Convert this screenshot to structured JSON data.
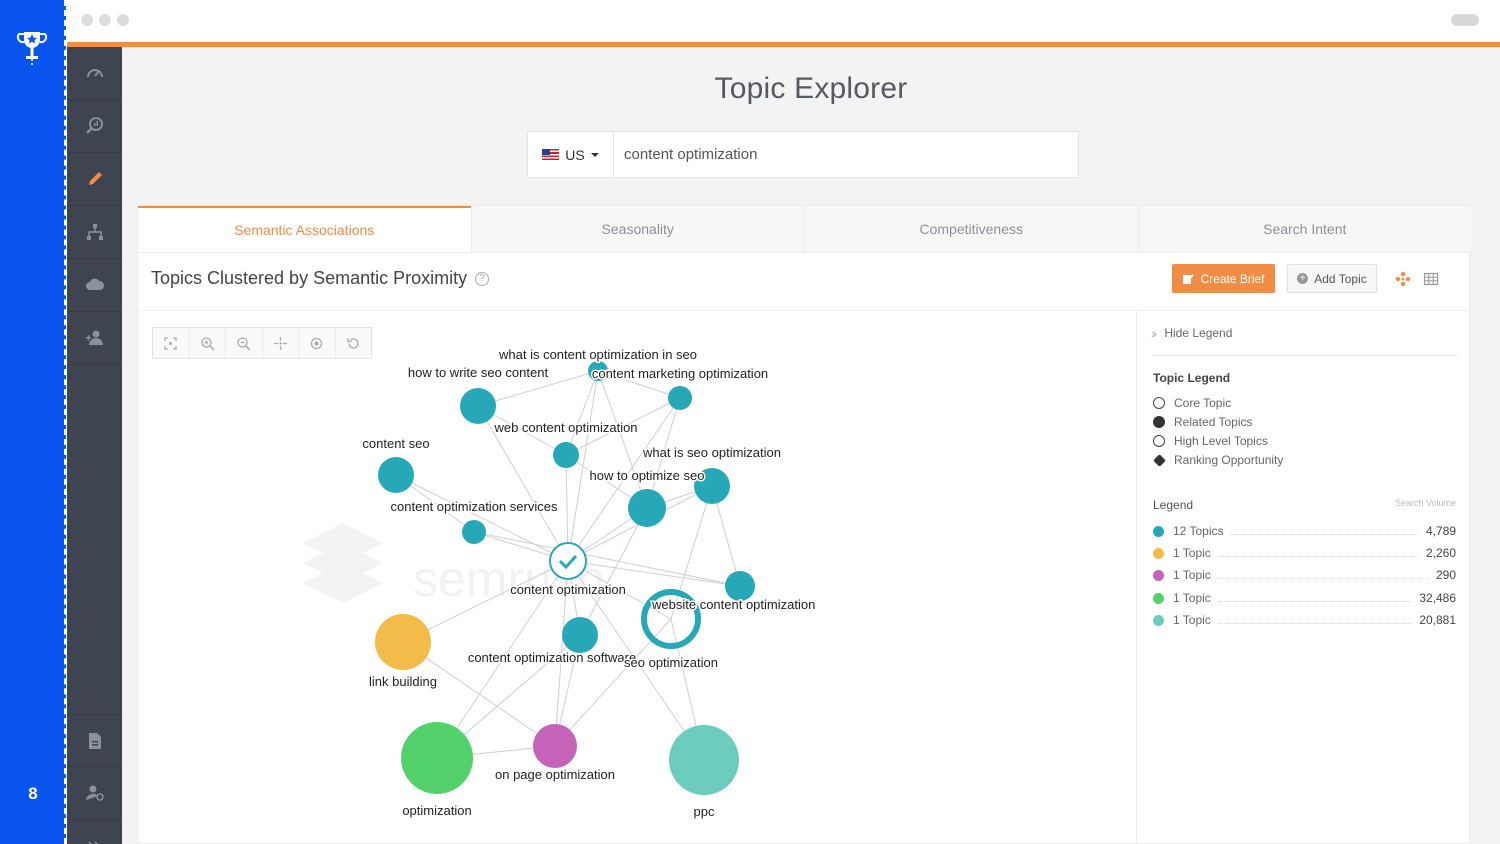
{
  "slide": {
    "number": "8"
  },
  "app": {
    "title": "Topic Explorer"
  },
  "search": {
    "country": "US",
    "query": "content optimization"
  },
  "tabs": [
    {
      "label": "Semantic Associations",
      "active": true
    },
    {
      "label": "Seasonality",
      "active": false
    },
    {
      "label": "Competitiveness",
      "active": false
    },
    {
      "label": "Search Intent",
      "active": false
    }
  ],
  "section": {
    "title": "Topics Clustered by Semantic Proximity"
  },
  "actions": {
    "create_brief": "Create Brief",
    "add_topic": "Add Topic"
  },
  "legend_panel": {
    "hide_label": "Hide Legend",
    "topic_legend_title": "Topic Legend",
    "topic_types": [
      "Core Topic",
      "Related Topics",
      "High Level Topics",
      "Ranking Opportunity"
    ],
    "legend_title": "Legend",
    "volume_header": "Search Volume",
    "rows": [
      {
        "label": "12 Topics",
        "volume": "4,789",
        "color": "#27a8b8"
      },
      {
        "label": "1 Topic",
        "volume": "2,260",
        "color": "#f2bb4a"
      },
      {
        "label": "1 Topic",
        "volume": "290",
        "color": "#c563b8"
      },
      {
        "label": "1 Topic",
        "volume": "32,486",
        "color": "#53d26c"
      },
      {
        "label": "1 Topic",
        "volume": "20,881",
        "color": "#6ccdbe"
      }
    ]
  },
  "graph": {
    "watermark": "semrush",
    "nodes": [
      {
        "id": "n0",
        "label": "content optimization",
        "color": "#ffffff",
        "kind": "core"
      },
      {
        "id": "n1",
        "label": "what is content optimization in seo",
        "color": "#27a8b8"
      },
      {
        "id": "n2",
        "label": "how to write seo content",
        "color": "#27a8b8"
      },
      {
        "id": "n3",
        "label": "content marketing optimization",
        "color": "#27a8b8"
      },
      {
        "id": "n4",
        "label": "web content optimization",
        "color": "#27a8b8"
      },
      {
        "id": "n5",
        "label": "content seo",
        "color": "#27a8b8"
      },
      {
        "id": "n6",
        "label": "what is seo optimization",
        "color": "#27a8b8"
      },
      {
        "id": "n7",
        "label": "how to optimize seo",
        "color": "#27a8b8"
      },
      {
        "id": "n8",
        "label": "content optimization services",
        "color": "#27a8b8"
      },
      {
        "id": "n9",
        "label": "",
        "color": "#27a8b8"
      },
      {
        "id": "n10",
        "label": "website content optimization",
        "color": "#27a8b8",
        "kind": "opportunity"
      },
      {
        "id": "n11",
        "label": "content optimization software",
        "color": "#27a8b8"
      },
      {
        "id": "n12",
        "label": "seo optimization",
        "color": "#27a8b8"
      },
      {
        "id": "n13",
        "label": "link building",
        "color": "#f2bb4a"
      },
      {
        "id": "n14",
        "label": "on page optimization",
        "color": "#c563b8"
      },
      {
        "id": "n15",
        "label": "optimization",
        "color": "#53d26c"
      },
      {
        "id": "n16",
        "label": "ppc",
        "color": "#6ccdbe"
      }
    ]
  }
}
